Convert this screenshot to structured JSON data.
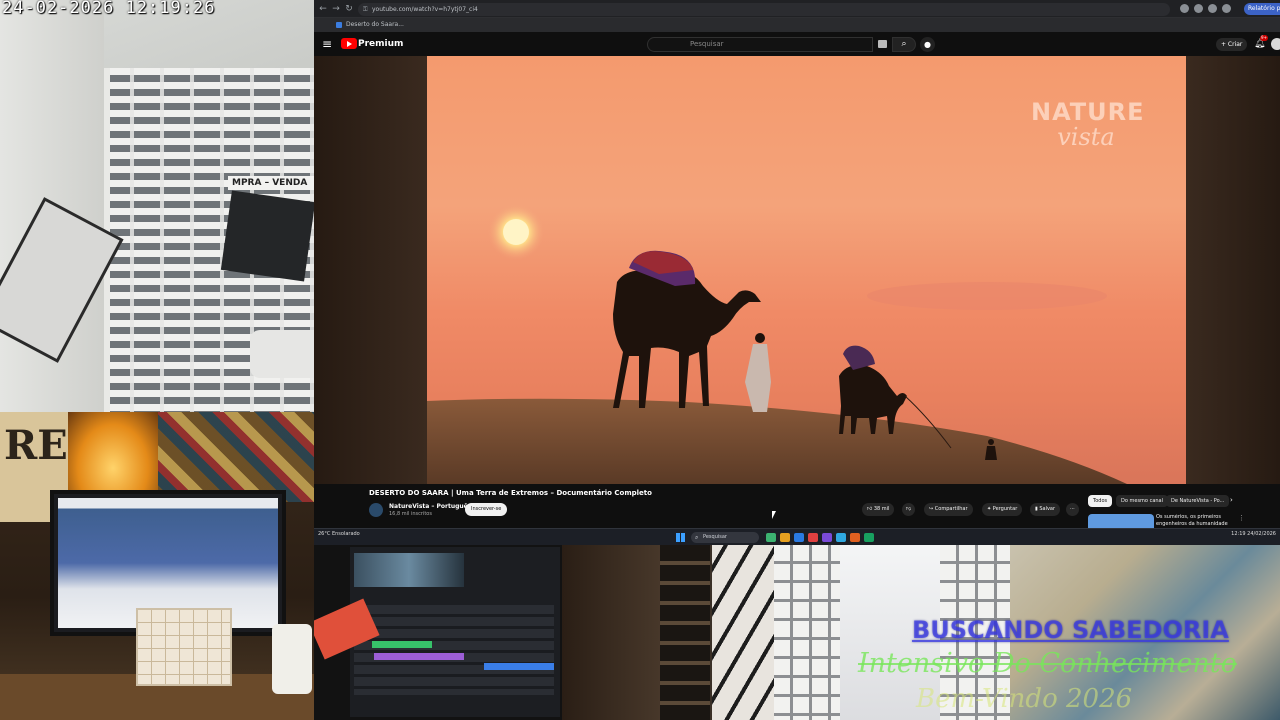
{
  "cctv": {
    "timestamp": "24-02-2026 12:19:26",
    "sign_text": "MPRA – VENDA"
  },
  "room": {
    "poster_text": "REP"
  },
  "browser": {
    "url": "youtube.com/watch?v=h7ytj07_ci4",
    "tab_title": "Deserto do Saara...",
    "profile_label": "Relatório pausado",
    "colors": {
      "accent": "#ff0000",
      "chrome": "#202124",
      "page": "#0f0f0f"
    }
  },
  "youtube": {
    "menu_icon": "hamburger-icon",
    "brand": "Premium",
    "search_placeholder": "Pesquisar",
    "create_label": "+ Criar",
    "notification_count": "9+",
    "video": {
      "watermark_line1": "NATURE",
      "watermark_line2": "vista",
      "title": "DESERTO DO SAARA | Uma Terra de Extremos – Documentário Completo",
      "channel": "NatureVista – Português",
      "subscribers": "16,8 mil inscritos",
      "subscribe_label": "Inscrever-se",
      "likes": "38 mil",
      "share_label": "Compartilhar",
      "ask_label": "Perguntar",
      "save_label": "Salvar",
      "more_label": "···"
    },
    "chips": [
      {
        "label": "Todos",
        "active": true
      },
      {
        "label": "Do mesmo canal",
        "active": false
      },
      {
        "label": "De NatureVista - Po...",
        "active": false
      }
    ],
    "recommendation": {
      "title": "Os sumérios, os primeiros engenheiros da humanidade"
    }
  },
  "taskbar": {
    "weather": "26°C Ensolarado",
    "search_placeholder": "Pesquisar",
    "tray": "12:19 24/02/2026",
    "apps": [
      "#3cb371",
      "#e6a020",
      "#2a7ae2",
      "#e04040",
      "#7a4ad8",
      "#2fa8e0",
      "#e06020",
      "#18a060"
    ]
  },
  "overlay": {
    "line1": "BUSCANDO SABEDORIA",
    "line2": "Intensivo Do Conhecimento",
    "line3": "Bem-Vindo 2026"
  }
}
